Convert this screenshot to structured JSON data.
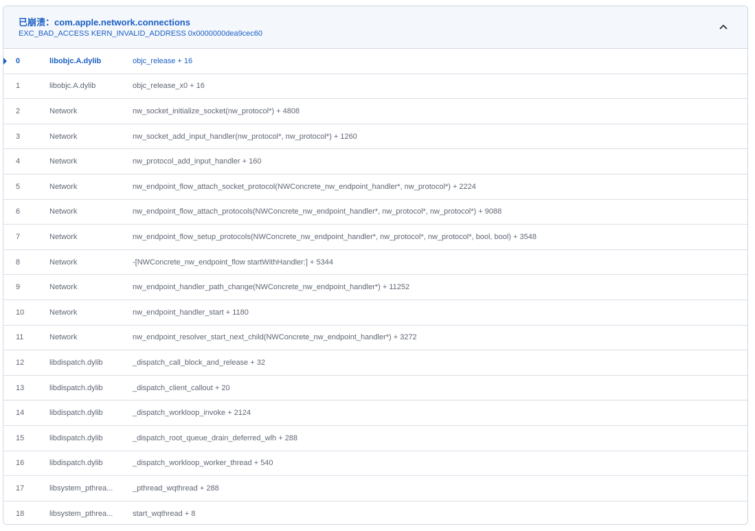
{
  "header": {
    "prefix": "已崩溃：",
    "process": "com.apple.network.connections",
    "exception": "EXC_BAD_ACCESS KERN_INVALID_ADDRESS 0x0000000dea9cec60"
  },
  "frames": [
    {
      "index": "0",
      "library": "libobjc.A.dylib",
      "symbol": "objc_release + 16",
      "active": true
    },
    {
      "index": "1",
      "library": "libobjc.A.dylib",
      "symbol": "objc_release_x0 + 16"
    },
    {
      "index": "2",
      "library": "Network",
      "symbol": "nw_socket_initialize_socket(nw_protocol*) + 4808"
    },
    {
      "index": "3",
      "library": "Network",
      "symbol": "nw_socket_add_input_handler(nw_protocol*, nw_protocol*) + 1260"
    },
    {
      "index": "4",
      "library": "Network",
      "symbol": "nw_protocol_add_input_handler + 160"
    },
    {
      "index": "5",
      "library": "Network",
      "symbol": "nw_endpoint_flow_attach_socket_protocol(NWConcrete_nw_endpoint_handler*, nw_protocol*) + 2224"
    },
    {
      "index": "6",
      "library": "Network",
      "symbol": "nw_endpoint_flow_attach_protocols(NWConcrete_nw_endpoint_handler*, nw_protocol*, nw_protocol*) + 9088"
    },
    {
      "index": "7",
      "library": "Network",
      "symbol": "nw_endpoint_flow_setup_protocols(NWConcrete_nw_endpoint_handler*, nw_protocol*, nw_protocol*, bool, bool) + 3548"
    },
    {
      "index": "8",
      "library": "Network",
      "symbol": "-[NWConcrete_nw_endpoint_flow startWithHandler:] + 5344"
    },
    {
      "index": "9",
      "library": "Network",
      "symbol": "nw_endpoint_handler_path_change(NWConcrete_nw_endpoint_handler*) + 11252"
    },
    {
      "index": "10",
      "library": "Network",
      "symbol": "nw_endpoint_handler_start + 1180"
    },
    {
      "index": "11",
      "library": "Network",
      "symbol": "nw_endpoint_resolver_start_next_child(NWConcrete_nw_endpoint_handler*) + 3272"
    },
    {
      "index": "12",
      "library": "libdispatch.dylib",
      "symbol": "_dispatch_call_block_and_release + 32"
    },
    {
      "index": "13",
      "library": "libdispatch.dylib",
      "symbol": "_dispatch_client_callout + 20"
    },
    {
      "index": "14",
      "library": "libdispatch.dylib",
      "symbol": "_dispatch_workloop_invoke + 2124"
    },
    {
      "index": "15",
      "library": "libdispatch.dylib",
      "symbol": "_dispatch_root_queue_drain_deferred_wlh + 288"
    },
    {
      "index": "16",
      "library": "libdispatch.dylib",
      "symbol": "_dispatch_workloop_worker_thread + 540"
    },
    {
      "index": "17",
      "library": "libsystem_pthrea...",
      "symbol": "_pthread_wqthread + 288"
    },
    {
      "index": "18",
      "library": "libsystem_pthrea...",
      "symbol": "start_wqthread + 8"
    }
  ],
  "colors": {
    "accent": "#1a5fc4",
    "text": "#5f6673",
    "header_bg": "#f4f7fc",
    "border": "#cfd6e0"
  },
  "icons": {
    "collapse": "chevron-up-icon",
    "current_frame": "triangle-right-icon"
  }
}
